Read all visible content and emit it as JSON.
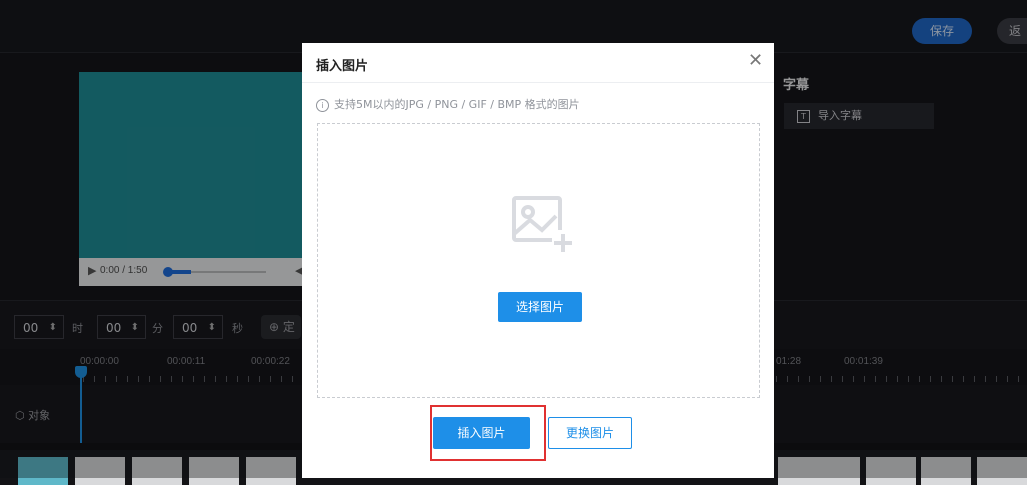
{
  "header": {
    "save_label": "保存",
    "back_label": "返"
  },
  "player": {
    "time": "0:00 / 1:50"
  },
  "subtitles": {
    "title": "字幕",
    "import_label": "导入字幕",
    "import_icon": "T"
  },
  "time_input": {
    "hours": "00",
    "hours_unit": "时",
    "minutes": "00",
    "minutes_unit": "分",
    "seconds": "00",
    "seconds_unit": "秒",
    "locate_label": "定"
  },
  "ruler": {
    "labels": [
      "00:00:00",
      "00:00:11",
      "00:00:22",
      "01:28",
      "00:01:39"
    ]
  },
  "track": {
    "label": "对象"
  },
  "modal": {
    "title": "插入图片",
    "hint": "支持5M以内的JPG / PNG / GIF / BMP 格式的图片",
    "select_label": "选择图片",
    "insert_label": "插入图片",
    "replace_label": "更换图片"
  },
  "colors": {
    "accent": "#1e8fe8",
    "save": "#1f66c4",
    "highlight": "#e03131",
    "video": "#1e8b94"
  }
}
